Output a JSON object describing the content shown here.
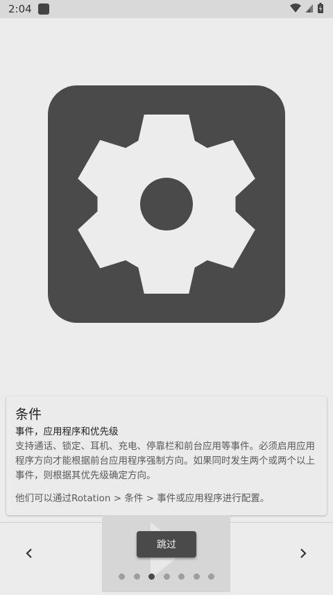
{
  "status_bar": {
    "time": "2:04"
  },
  "card": {
    "title": "条件",
    "subtitle": "事件，应用程序和优先级",
    "body": "支持通话、锁定、耳机、充电、停靠栏和前台应用等事件。必须启用应用程序方向才能根据前台应用程序强制方向。如果同时发生两个或两个以上事件，则根据其优先级确定方向。",
    "footer": "他们可以通过Rotation > 条件 > 事件或应用程序进行配置。"
  },
  "controls": {
    "skip_label": "跳过",
    "prev_icon": "chevron-left-icon",
    "next_icon": "chevron-right-icon"
  },
  "pager": {
    "total": 7,
    "current": 3
  },
  "colors": {
    "accent": "#4a4a4a",
    "background": "#ececec",
    "dot_inactive": "#9e9e9e"
  }
}
